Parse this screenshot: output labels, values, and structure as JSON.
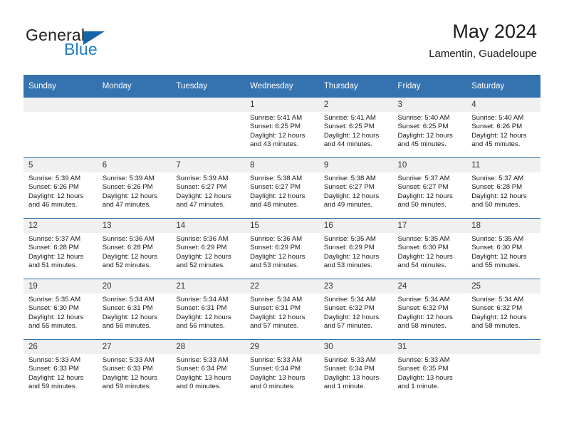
{
  "logo": {
    "line1": "General",
    "line2": "Blue",
    "triangle_color": "#1565a8",
    "blue_text_color": "#1f7bc1"
  },
  "header": {
    "title": "May 2024",
    "subtitle": "Lamentin, Guadeloupe"
  },
  "theme": {
    "header_blue": "#3572b0",
    "daynum_background": "#f0f0f0",
    "text_color": "#1a1a1a"
  },
  "weekdays": [
    "Sunday",
    "Monday",
    "Tuesday",
    "Wednesday",
    "Thursday",
    "Friday",
    "Saturday"
  ],
  "labels": {
    "sunrise_prefix": "Sunrise:",
    "sunset_prefix": "Sunset:",
    "daylight_prefix": "Daylight:"
  },
  "weeks": [
    [
      {
        "day": "",
        "sunrise": "",
        "sunset": "",
        "daylight_line1": "",
        "daylight_line2": ""
      },
      {
        "day": "",
        "sunrise": "",
        "sunset": "",
        "daylight_line1": "",
        "daylight_line2": ""
      },
      {
        "day": "",
        "sunrise": "",
        "sunset": "",
        "daylight_line1": "",
        "daylight_line2": ""
      },
      {
        "day": "1",
        "sunrise": "Sunrise: 5:41 AM",
        "sunset": "Sunset: 6:25 PM",
        "daylight_line1": "Daylight: 12 hours",
        "daylight_line2": "and 43 minutes."
      },
      {
        "day": "2",
        "sunrise": "Sunrise: 5:41 AM",
        "sunset": "Sunset: 6:25 PM",
        "daylight_line1": "Daylight: 12 hours",
        "daylight_line2": "and 44 minutes."
      },
      {
        "day": "3",
        "sunrise": "Sunrise: 5:40 AM",
        "sunset": "Sunset: 6:25 PM",
        "daylight_line1": "Daylight: 12 hours",
        "daylight_line2": "and 45 minutes."
      },
      {
        "day": "4",
        "sunrise": "Sunrise: 5:40 AM",
        "sunset": "Sunset: 6:26 PM",
        "daylight_line1": "Daylight: 12 hours",
        "daylight_line2": "and 45 minutes."
      }
    ],
    [
      {
        "day": "5",
        "sunrise": "Sunrise: 5:39 AM",
        "sunset": "Sunset: 6:26 PM",
        "daylight_line1": "Daylight: 12 hours",
        "daylight_line2": "and 46 minutes."
      },
      {
        "day": "6",
        "sunrise": "Sunrise: 5:39 AM",
        "sunset": "Sunset: 6:26 PM",
        "daylight_line1": "Daylight: 12 hours",
        "daylight_line2": "and 47 minutes."
      },
      {
        "day": "7",
        "sunrise": "Sunrise: 5:39 AM",
        "sunset": "Sunset: 6:27 PM",
        "daylight_line1": "Daylight: 12 hours",
        "daylight_line2": "and 47 minutes."
      },
      {
        "day": "8",
        "sunrise": "Sunrise: 5:38 AM",
        "sunset": "Sunset: 6:27 PM",
        "daylight_line1": "Daylight: 12 hours",
        "daylight_line2": "and 48 minutes."
      },
      {
        "day": "9",
        "sunrise": "Sunrise: 5:38 AM",
        "sunset": "Sunset: 6:27 PM",
        "daylight_line1": "Daylight: 12 hours",
        "daylight_line2": "and 49 minutes."
      },
      {
        "day": "10",
        "sunrise": "Sunrise: 5:37 AM",
        "sunset": "Sunset: 6:27 PM",
        "daylight_line1": "Daylight: 12 hours",
        "daylight_line2": "and 50 minutes."
      },
      {
        "day": "11",
        "sunrise": "Sunrise: 5:37 AM",
        "sunset": "Sunset: 6:28 PM",
        "daylight_line1": "Daylight: 12 hours",
        "daylight_line2": "and 50 minutes."
      }
    ],
    [
      {
        "day": "12",
        "sunrise": "Sunrise: 5:37 AM",
        "sunset": "Sunset: 6:28 PM",
        "daylight_line1": "Daylight: 12 hours",
        "daylight_line2": "and 51 minutes."
      },
      {
        "day": "13",
        "sunrise": "Sunrise: 5:36 AM",
        "sunset": "Sunset: 6:28 PM",
        "daylight_line1": "Daylight: 12 hours",
        "daylight_line2": "and 52 minutes."
      },
      {
        "day": "14",
        "sunrise": "Sunrise: 5:36 AM",
        "sunset": "Sunset: 6:29 PM",
        "daylight_line1": "Daylight: 12 hours",
        "daylight_line2": "and 52 minutes."
      },
      {
        "day": "15",
        "sunrise": "Sunrise: 5:36 AM",
        "sunset": "Sunset: 6:29 PM",
        "daylight_line1": "Daylight: 12 hours",
        "daylight_line2": "and 53 minutes."
      },
      {
        "day": "16",
        "sunrise": "Sunrise: 5:35 AM",
        "sunset": "Sunset: 6:29 PM",
        "daylight_line1": "Daylight: 12 hours",
        "daylight_line2": "and 53 minutes."
      },
      {
        "day": "17",
        "sunrise": "Sunrise: 5:35 AM",
        "sunset": "Sunset: 6:30 PM",
        "daylight_line1": "Daylight: 12 hours",
        "daylight_line2": "and 54 minutes."
      },
      {
        "day": "18",
        "sunrise": "Sunrise: 5:35 AM",
        "sunset": "Sunset: 6:30 PM",
        "daylight_line1": "Daylight: 12 hours",
        "daylight_line2": "and 55 minutes."
      }
    ],
    [
      {
        "day": "19",
        "sunrise": "Sunrise: 5:35 AM",
        "sunset": "Sunset: 6:30 PM",
        "daylight_line1": "Daylight: 12 hours",
        "daylight_line2": "and 55 minutes."
      },
      {
        "day": "20",
        "sunrise": "Sunrise: 5:34 AM",
        "sunset": "Sunset: 6:31 PM",
        "daylight_line1": "Daylight: 12 hours",
        "daylight_line2": "and 56 minutes."
      },
      {
        "day": "21",
        "sunrise": "Sunrise: 5:34 AM",
        "sunset": "Sunset: 6:31 PM",
        "daylight_line1": "Daylight: 12 hours",
        "daylight_line2": "and 56 minutes."
      },
      {
        "day": "22",
        "sunrise": "Sunrise: 5:34 AM",
        "sunset": "Sunset: 6:31 PM",
        "daylight_line1": "Daylight: 12 hours",
        "daylight_line2": "and 57 minutes."
      },
      {
        "day": "23",
        "sunrise": "Sunrise: 5:34 AM",
        "sunset": "Sunset: 6:32 PM",
        "daylight_line1": "Daylight: 12 hours",
        "daylight_line2": "and 57 minutes."
      },
      {
        "day": "24",
        "sunrise": "Sunrise: 5:34 AM",
        "sunset": "Sunset: 6:32 PM",
        "daylight_line1": "Daylight: 12 hours",
        "daylight_line2": "and 58 minutes."
      },
      {
        "day": "25",
        "sunrise": "Sunrise: 5:34 AM",
        "sunset": "Sunset: 6:32 PM",
        "daylight_line1": "Daylight: 12 hours",
        "daylight_line2": "and 58 minutes."
      }
    ],
    [
      {
        "day": "26",
        "sunrise": "Sunrise: 5:33 AM",
        "sunset": "Sunset: 6:33 PM",
        "daylight_line1": "Daylight: 12 hours",
        "daylight_line2": "and 59 minutes."
      },
      {
        "day": "27",
        "sunrise": "Sunrise: 5:33 AM",
        "sunset": "Sunset: 6:33 PM",
        "daylight_line1": "Daylight: 12 hours",
        "daylight_line2": "and 59 minutes."
      },
      {
        "day": "28",
        "sunrise": "Sunrise: 5:33 AM",
        "sunset": "Sunset: 6:34 PM",
        "daylight_line1": "Daylight: 13 hours",
        "daylight_line2": "and 0 minutes."
      },
      {
        "day": "29",
        "sunrise": "Sunrise: 5:33 AM",
        "sunset": "Sunset: 6:34 PM",
        "daylight_line1": "Daylight: 13 hours",
        "daylight_line2": "and 0 minutes."
      },
      {
        "day": "30",
        "sunrise": "Sunrise: 5:33 AM",
        "sunset": "Sunset: 6:34 PM",
        "daylight_line1": "Daylight: 13 hours",
        "daylight_line2": "and 1 minute."
      },
      {
        "day": "31",
        "sunrise": "Sunrise: 5:33 AM",
        "sunset": "Sunset: 6:35 PM",
        "daylight_line1": "Daylight: 13 hours",
        "daylight_line2": "and 1 minute."
      },
      {
        "day": "",
        "sunrise": "",
        "sunset": "",
        "daylight_line1": "",
        "daylight_line2": ""
      }
    ]
  ]
}
